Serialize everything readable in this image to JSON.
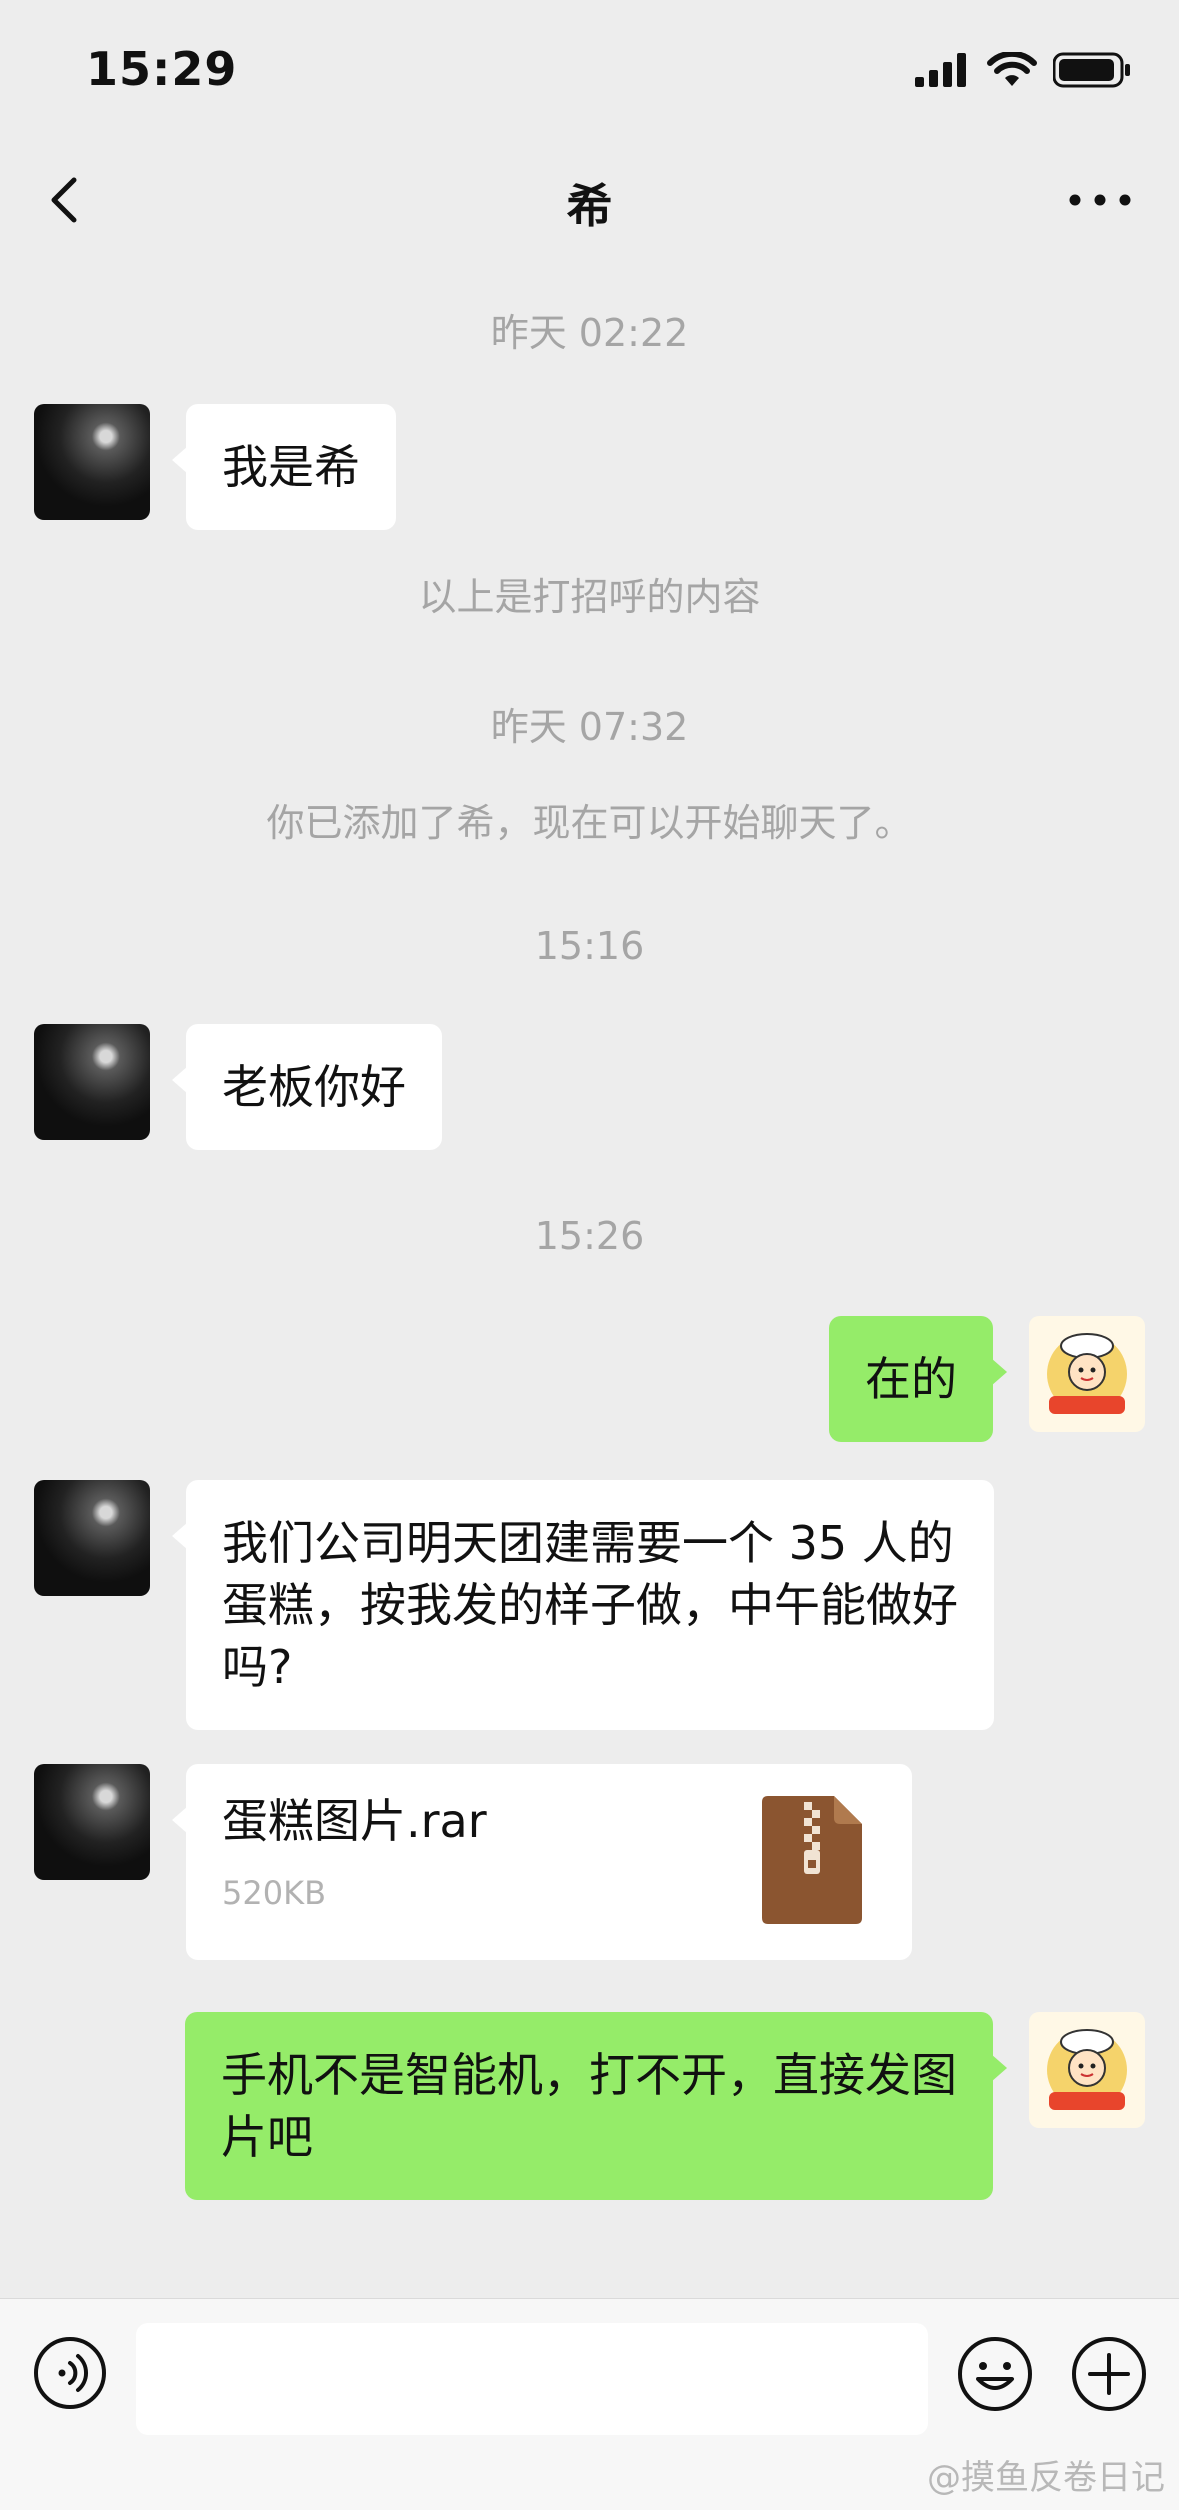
{
  "status_bar": {
    "time": "15:29"
  },
  "header": {
    "title": "希"
  },
  "messages": {
    "time_1": "昨天 02:22",
    "msg_1": "我是希",
    "note_1": "以上是打招呼的内容",
    "time_2": "昨天 07:32",
    "note_2": "你已添加了希，现在可以开始聊天了。",
    "time_3": "15:16",
    "msg_2": "老板你好",
    "time_4": "15:26",
    "msg_3": "在的",
    "msg_4": "我们公司明天团建需要一个 35 人的蛋糕，按我发的样子做，中午能做好吗?",
    "file_name": "蛋糕图片.rar",
    "file_size": "520KB",
    "msg_5": "手机不是智能机，打不开，直接发图片吧"
  },
  "input_bar": {
    "placeholder": ""
  },
  "watermark": "@摸鱼反卷日记",
  "icons": [
    "back-icon",
    "more-icon",
    "signal-icon",
    "wifi-icon",
    "battery-icon",
    "voice-icon",
    "emoji-icon",
    "plus-icon",
    "zip-file-icon"
  ],
  "colors": {
    "background": "#ededed",
    "self_bubble": "#95ec69",
    "other_bubble": "#ffffff",
    "system_text": "#a5a5a5"
  }
}
